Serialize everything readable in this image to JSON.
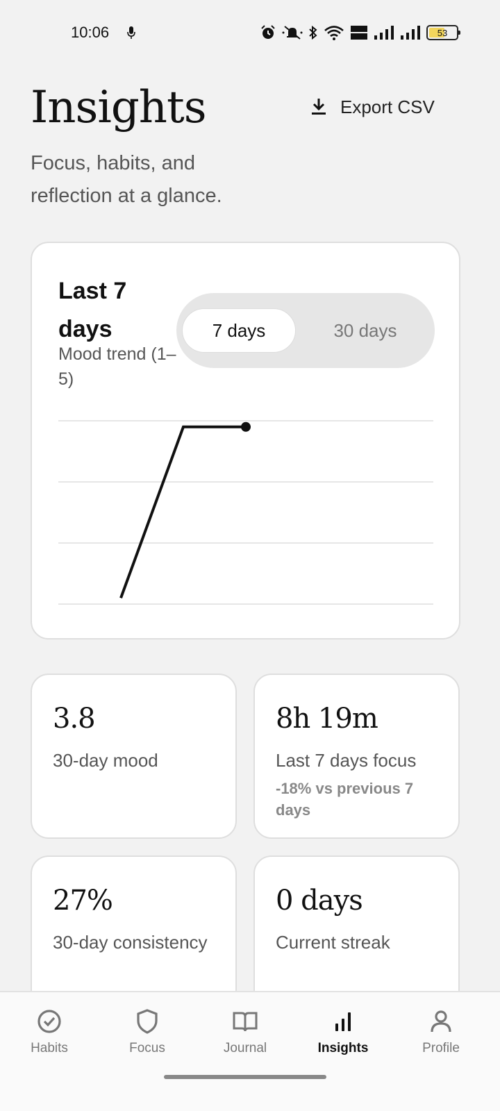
{
  "status": {
    "time": "10:06",
    "battery": "53"
  },
  "header": {
    "title": "Insights",
    "subtitle": "Focus, habits, and reflection at a glance.",
    "export_label": "Export CSV"
  },
  "trend": {
    "title": "Last 7 days",
    "subtitle": "Mood trend (1–5)",
    "toggle": {
      "active": "7 days",
      "inactive": "30 days"
    }
  },
  "chart_data": {
    "type": "line",
    "title": "Last 7 days",
    "subtitle": "Mood trend (1–5)",
    "x": [
      1,
      2,
      3
    ],
    "series": [
      {
        "values": [
          1.1,
          3.9,
          3.9
        ]
      }
    ],
    "xlim": [
      0,
      6
    ],
    "ylim": [
      1,
      4
    ],
    "grid": true,
    "color": "#111111"
  },
  "stats": [
    {
      "value": "3.8",
      "label": "30-day mood",
      "note": ""
    },
    {
      "value": "8h 19m",
      "label": "Last 7 days focus",
      "note": "-18% vs previous 7 days"
    },
    {
      "value": "27%",
      "label": "30-day consistency",
      "note": ""
    },
    {
      "value": "0 days",
      "label": "Current streak",
      "note": ""
    }
  ],
  "nav": [
    {
      "label": "Habits",
      "icon": "check-circle-icon"
    },
    {
      "label": "Focus",
      "icon": "shield-icon"
    },
    {
      "label": "Journal",
      "icon": "book-icon"
    },
    {
      "label": "Insights",
      "icon": "bar-chart-icon",
      "active": true
    },
    {
      "label": "Profile",
      "icon": "person-icon"
    }
  ]
}
